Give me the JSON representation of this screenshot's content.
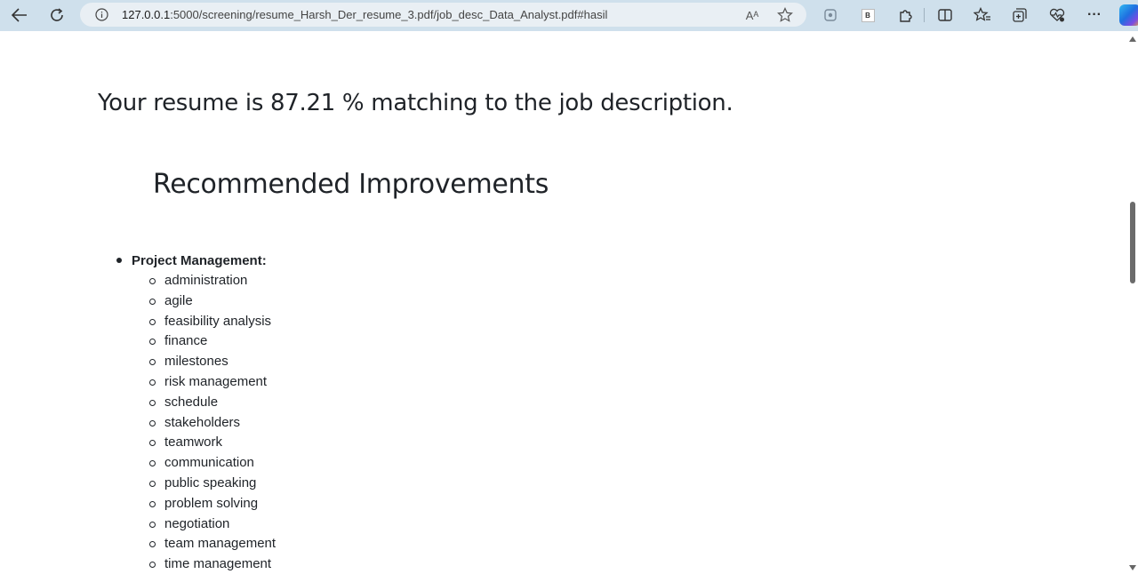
{
  "browser": {
    "url_host": "127.0.0.1",
    "url_path": ":5000/screening/resume_Harsh_Der_resume_3.pdf/job_desc_Data_Analyst.pdf#hasil",
    "icons": [
      "back-icon",
      "refresh-icon",
      "info-icon",
      "read-aloud-icon",
      "favorite-star-icon",
      "extension-icon",
      "b-badge-icon",
      "puzzle-icon",
      "split-screen-icon",
      "favorites-icon",
      "collections-icon",
      "performance-icon",
      "more-icon",
      "copilot-icon"
    ],
    "b_badge": "B",
    "read_aloud": "Aᴬ",
    "more": "···"
  },
  "page": {
    "result_text": "Your resume is 87.21 % matching to the job description.",
    "recommendations_title": "Recommended Improvements",
    "categories": [
      {
        "label": "Project Management:",
        "skills": [
          "administration",
          "agile",
          "feasibility analysis",
          "finance",
          "milestones",
          "risk management",
          "schedule",
          "stakeholders",
          "teamwork",
          "communication",
          "public speaking",
          "problem solving",
          "negotiation",
          "team management",
          "time management"
        ]
      }
    ]
  },
  "colors": {
    "toolbar_bg": "#cfe0ec",
    "address_bg": "#e9eff4",
    "text": "#1f2328"
  }
}
